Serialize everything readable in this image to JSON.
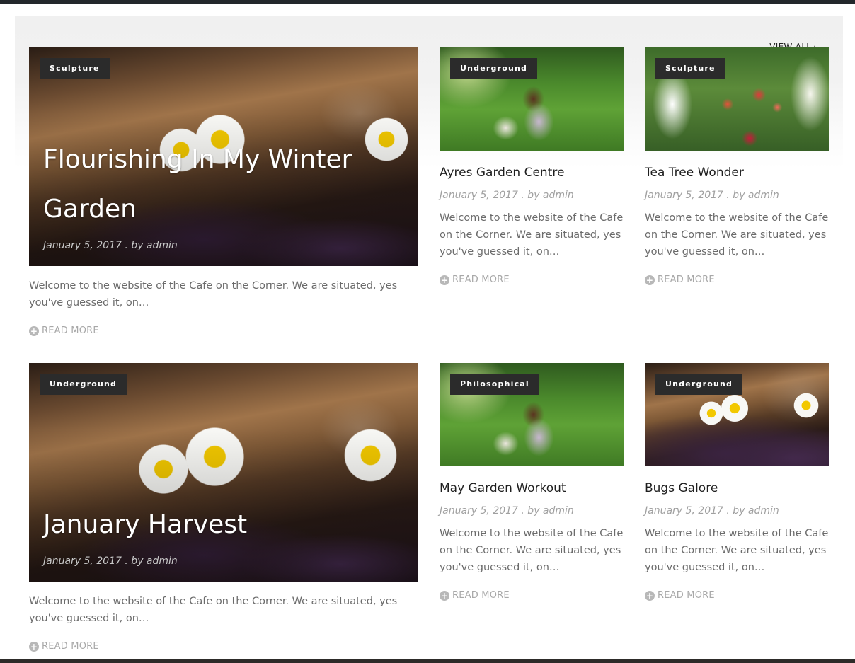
{
  "header": {
    "view_all_label": "VIEW ALL",
    "view_all_icon": "chevron-right-icon"
  },
  "posts": [
    {
      "category": "Sculpture",
      "title": "Flourishing In My Winter Garden",
      "meta": "January 5, 2017 . by admin",
      "excerpt": "Welcome to the website of the Cafe on the Corner. We are situated, yes you've guessed it, on…",
      "read_more": "READ MORE"
    },
    {
      "category": "Underground",
      "title": "Ayres Garden Centre",
      "meta": "January 5, 2017 . by admin",
      "excerpt": "Welcome to the website of the Cafe on the Corner. We are situated, yes you've guessed it, on…",
      "read_more": "READ MORE"
    },
    {
      "category": "Sculpture",
      "title": "Tea Tree Wonder",
      "meta": "January 5, 2017 . by admin",
      "excerpt": "Welcome to the website of the Cafe on the Corner. We are situated, yes you've guessed it, on…",
      "read_more": "READ MORE"
    },
    {
      "category": "Underground",
      "title": "January Harvest",
      "meta": "January 5, 2017 . by admin",
      "excerpt": "Welcome to the website of the Cafe on the Corner. We are situated, yes you've guessed it, on…",
      "read_more": "READ MORE"
    },
    {
      "category": "Philosophical",
      "title": "May Garden Workout",
      "meta": "January 5, 2017 . by admin",
      "excerpt": "Welcome to the website of the Cafe on the Corner. We are situated, yes you've guessed it, on…",
      "read_more": "READ MORE"
    },
    {
      "category": "Underground",
      "title": "Bugs Galore",
      "meta": "January 5, 2017 . by admin",
      "excerpt": "Welcome to the website of the Cafe on the Corner. We are situated, yes you've guessed it, on…",
      "read_more": "READ MORE"
    }
  ]
}
